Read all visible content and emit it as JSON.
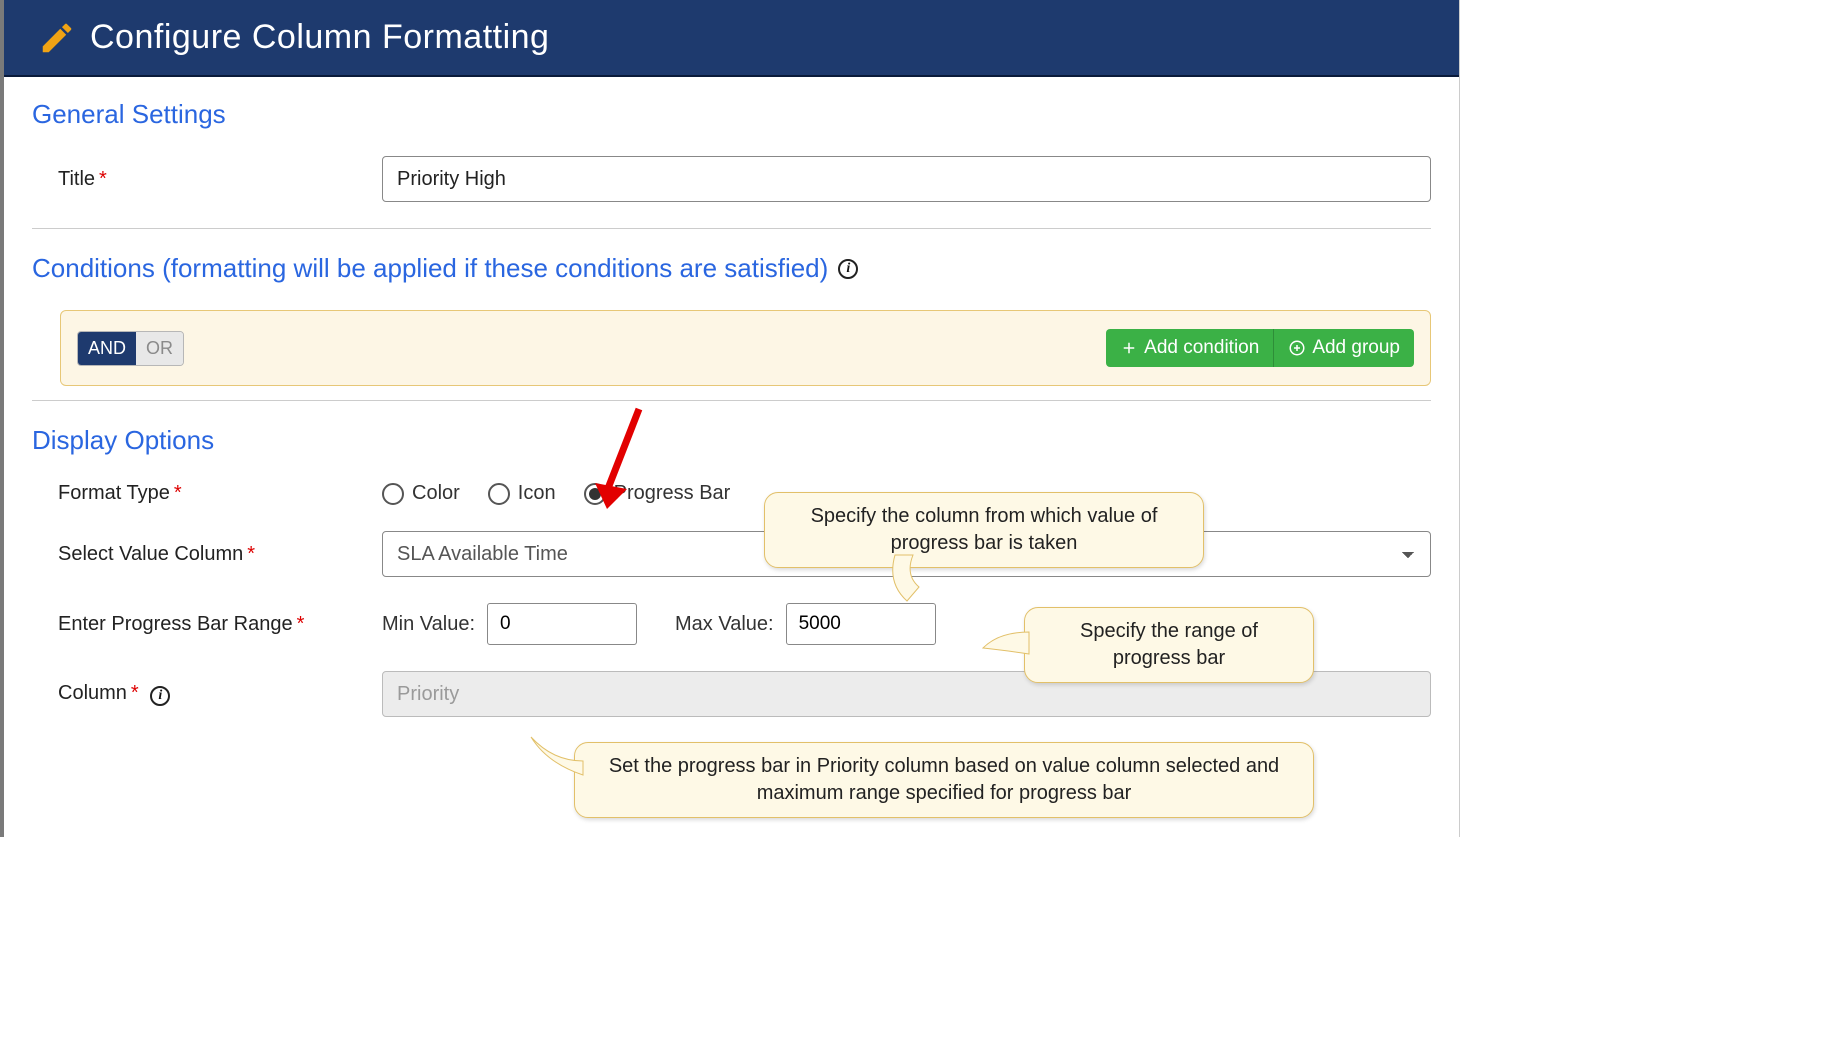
{
  "header": {
    "title": "Configure Column Formatting"
  },
  "sections": {
    "general": "General Settings",
    "conditions": "Conditions (formatting will be applied if these conditions are satisfied)",
    "display": "Display Options"
  },
  "general": {
    "title_label": "Title",
    "title_value": "Priority High"
  },
  "conditions": {
    "and": "AND",
    "or": "OR",
    "add_condition": "Add condition",
    "add_group": "Add group"
  },
  "display": {
    "format_type_label": "Format Type",
    "options": {
      "color": "Color",
      "icon": "Icon",
      "progress": "Progress Bar"
    },
    "selected_option": "progress",
    "select_value_label": "Select Value Column",
    "select_value_value": "SLA Available Time",
    "range_label": "Enter Progress Bar Range",
    "min_label": "Min Value:",
    "min_value": "0",
    "max_label": "Max Value:",
    "max_value": "5000",
    "column_label": "Column",
    "column_value": "Priority"
  },
  "callouts": {
    "c1": "Specify the column from which value of progress bar is taken",
    "c2": "Specify the range of progress bar",
    "c3": "Set the progress bar in Priority column based on value column selected and maximum range specified for progress bar"
  }
}
